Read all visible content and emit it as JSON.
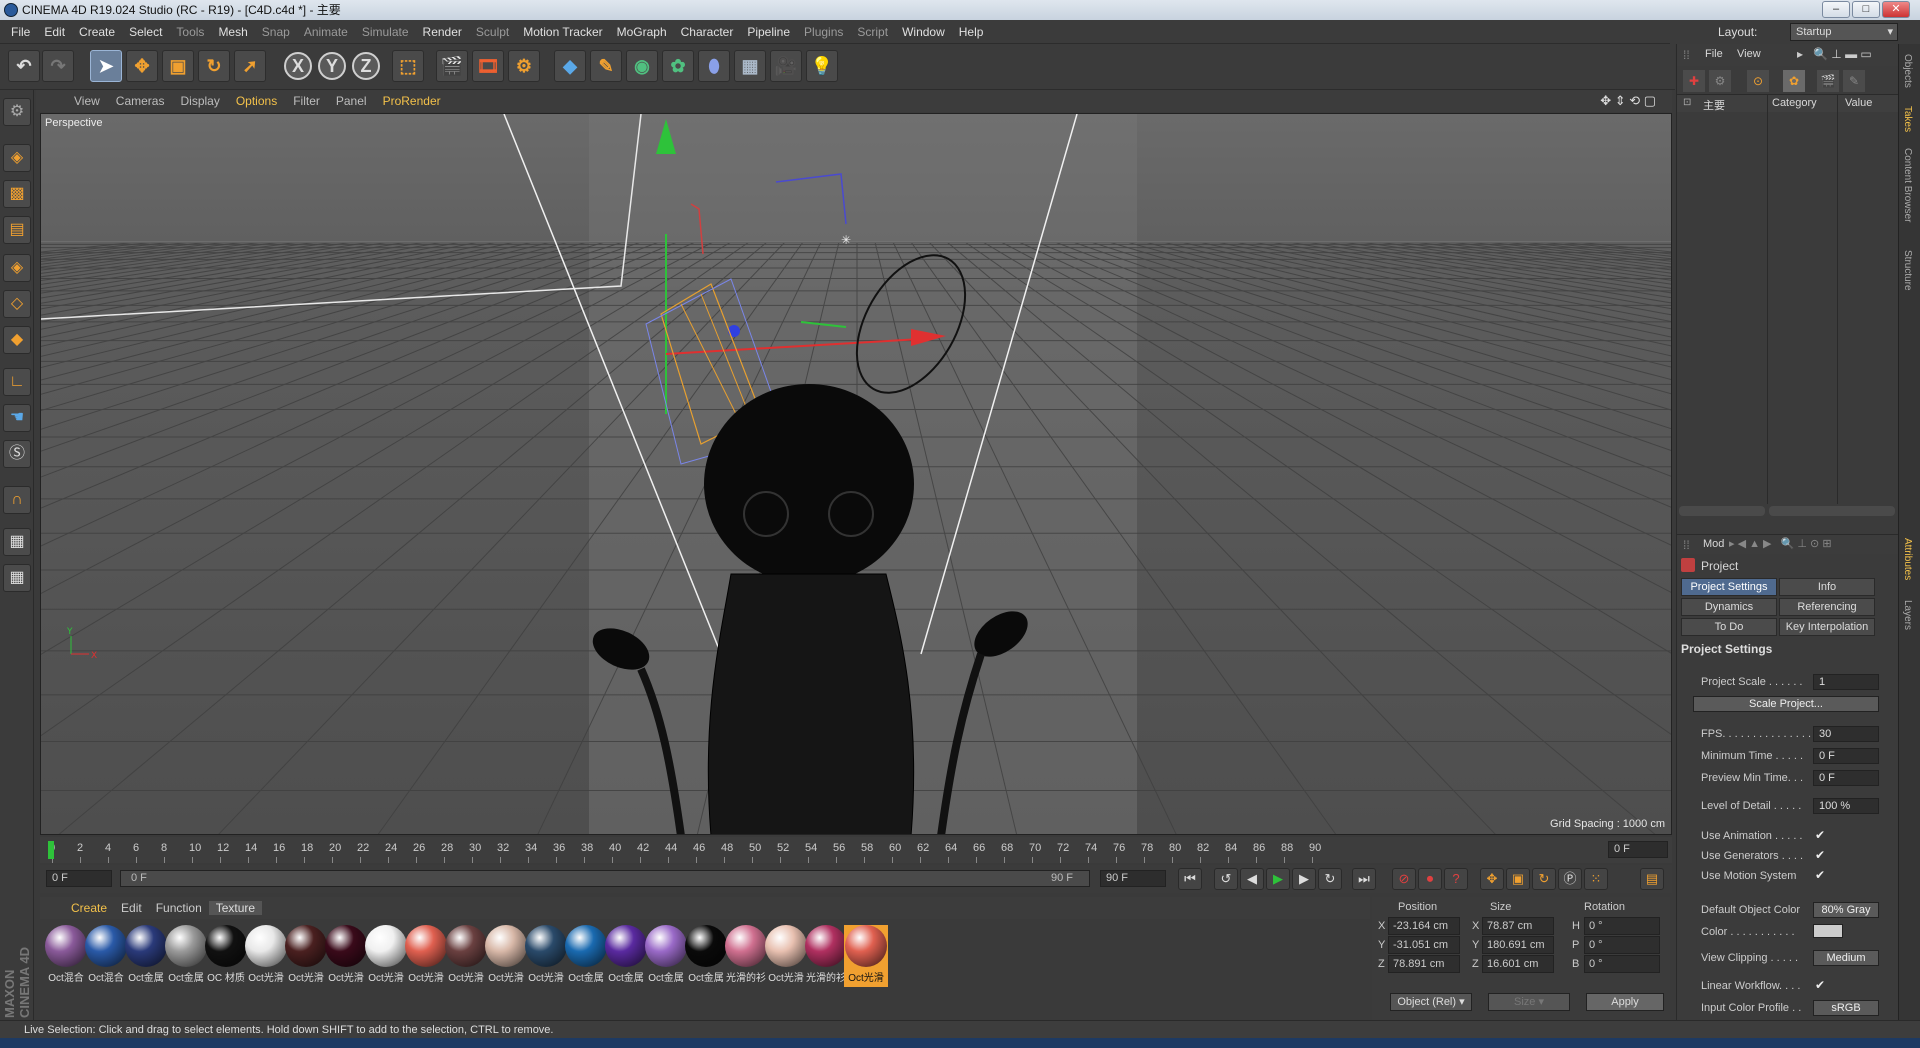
{
  "window": {
    "title": "CINEMA 4D R19.024 Studio (RC - R19) - [C4D.c4d *] - 主要"
  },
  "menu": [
    "File",
    "Edit",
    "Create",
    "Select",
    "Tools",
    "Mesh",
    "Snap",
    "Animate",
    "Simulate",
    "Render",
    "Sculpt",
    "Motion Tracker",
    "MoGraph",
    "Character",
    "Pipeline",
    "Plugins",
    "Script",
    "Window",
    "Help"
  ],
  "layout": {
    "label": "Layout:",
    "value": "Startup"
  },
  "viewport": {
    "menu": [
      "View",
      "Cameras",
      "Display",
      "Options",
      "Filter",
      "Panel",
      "ProRender"
    ],
    "label": "Perspective",
    "grid_spacing": "Grid Spacing : 1000 cm"
  },
  "timeline": {
    "ticks": [
      "0",
      "2",
      "4",
      "6",
      "8",
      "10",
      "12",
      "14",
      "16",
      "18",
      "20",
      "22",
      "24",
      "26",
      "28",
      "30",
      "32",
      "34",
      "36",
      "38",
      "40",
      "42",
      "44",
      "46",
      "48",
      "50",
      "52",
      "54",
      "56",
      "58",
      "60",
      "62",
      "64",
      "66",
      "68",
      "70",
      "72",
      "74",
      "76",
      "78",
      "80",
      "82",
      "84",
      "86",
      "88",
      "90"
    ],
    "current": "0 F",
    "start": "0 F",
    "range_start": "0 F",
    "range_end": "90 F",
    "end": "90 F"
  },
  "materials_menu": [
    "Create",
    "Edit",
    "Function",
    "Texture"
  ],
  "materials": [
    {
      "label": "Oct混合",
      "color": "#8a5a9a"
    },
    {
      "label": "Oct混合",
      "color": "#2a5aa8"
    },
    {
      "label": "Oct金属",
      "color": "#2a3a7a"
    },
    {
      "label": "Oct金属",
      "color": "#9a9a9a"
    },
    {
      "label": "OC 材质",
      "color": "#111111"
    },
    {
      "label": "Oct光滑",
      "color": "#e8e8e8"
    },
    {
      "label": "Oct光滑",
      "color": "#4a2020"
    },
    {
      "label": "Oct光滑",
      "color": "#3a0a1a"
    },
    {
      "label": "Oct光滑",
      "color": "#f0f0f0"
    },
    {
      "label": "Oct光滑",
      "color": "#e06050"
    },
    {
      "label": "Oct光滑",
      "color": "#6a4040"
    },
    {
      "label": "Oct光滑",
      "color": "#d8b8a8"
    },
    {
      "label": "Oct光滑",
      "color": "#2a4a6a"
    },
    {
      "label": "Oct金属",
      "color": "#1a6ab0"
    },
    {
      "label": "Oct金属",
      "color": "#5a2aa0"
    },
    {
      "label": "Oct金属",
      "color": "#9a6ac8"
    },
    {
      "label": "Oct金属",
      "color": "#0a0a0a"
    },
    {
      "label": "光滑的衫",
      "color": "#d07090"
    },
    {
      "label": "Oct光滑",
      "color": "#e8c0b0"
    },
    {
      "label": "光滑的衫",
      "color": "#b03060"
    },
    {
      "label": "Oct光滑",
      "color": "#e06050"
    }
  ],
  "coordinates": {
    "headers": [
      "Position",
      "Size",
      "Rotation"
    ],
    "rows": [
      {
        "axis": "X",
        "pos": "-23.164 cm",
        "size_axis": "X",
        "size": "78.87 cm",
        "rot_axis": "H",
        "rot": "0 °"
      },
      {
        "axis": "Y",
        "pos": "-31.051 cm",
        "size_axis": "Y",
        "size": "180.691 cm",
        "rot_axis": "P",
        "rot": "0 °"
      },
      {
        "axis": "Z",
        "pos": "78.891 cm",
        "size_axis": "Z",
        "size": "16.601 cm",
        "rot_axis": "B",
        "rot": "0 °"
      }
    ],
    "mode": "Object (Rel)",
    "size_mode": "Size",
    "apply": "Apply"
  },
  "objects_panel": {
    "menu": [
      "File",
      "View"
    ],
    "tree_root": "主要",
    "columns": [
      "Category",
      "Value"
    ]
  },
  "attributes": {
    "menu": "Mod",
    "title": "Project",
    "tabs": [
      "Project Settings",
      "Info",
      "Dynamics",
      "Referencing",
      "To Do",
      "Key Interpolation"
    ],
    "section": "Project Settings",
    "fields": [
      {
        "label": "Project Scale . . . . . .",
        "value": "1"
      },
      {
        "label": "FPS. . . . . . . . . . . . . . .",
        "value": "30"
      },
      {
        "label": "Minimum Time . . . . .",
        "value": "0 F"
      },
      {
        "label": "Preview Min Time. . .",
        "value": "0 F"
      },
      {
        "label": "Level of Detail . . . . .",
        "value": "100 %"
      }
    ],
    "scale_button": "Scale Project...",
    "checks": [
      {
        "label": "Use Animation . . . . .",
        "value": "✔"
      },
      {
        "label": "Use Generators . . . .",
        "value": "✔"
      },
      {
        "label": "Use Motion System",
        "value": "✔"
      }
    ],
    "default_color_label": "Default Object Color",
    "default_color_value": "80% Gray",
    "color_label": "Color . . . . . . . . . . .",
    "view_clipping_label": "View Clipping . . . . .",
    "view_clipping_value": "Medium",
    "linear_workflow_label": "Linear Workflow. . . .",
    "linear_workflow_value": "✔",
    "input_profile_label": "Input Color Profile . .",
    "input_profile_value": "sRGB"
  },
  "side_tabs": [
    "Objects",
    "Takes",
    "Content Browser",
    "Structure",
    "Attributes",
    "Layers"
  ],
  "status": "Live Selection: Click and drag to select elements. Hold down SHIFT to add to the selection, CTRL to remove."
}
